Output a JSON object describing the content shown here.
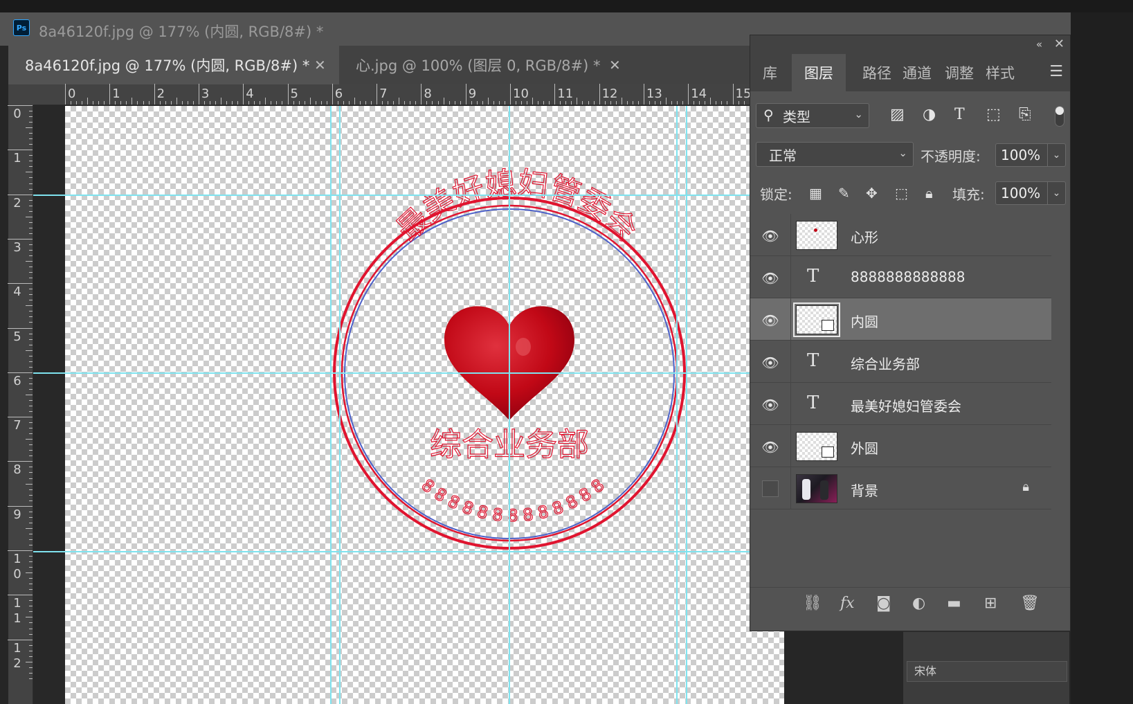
{
  "window": {
    "title": "8a46120f.jpg @ 177% (内圆, RGB/8#) *",
    "app_icon": "Ps"
  },
  "tabs": [
    {
      "label": "8a46120f.jpg @ 177% (内圆, RGB/8#) *",
      "active": true
    },
    {
      "label": "心.jpg @ 100% (图层 0, RGB/8#) *",
      "active": false
    }
  ],
  "ruler": {
    "top_labels": [
      "0",
      "1",
      "2",
      "3",
      "4",
      "5",
      "6",
      "7",
      "8",
      "9",
      "10",
      "11",
      "12",
      "13",
      "14",
      "15"
    ],
    "left_labels": [
      "0",
      "1",
      "2",
      "3",
      "4",
      "5",
      "6",
      "7",
      "8",
      "9",
      "10",
      "11",
      "12"
    ]
  },
  "stamp": {
    "arc_text": "最美好媳妇管委会",
    "department_text": "综合业务部",
    "number_text": "8888888888888",
    "color": "#e0142f"
  },
  "guides_color": "#7fe3ef",
  "panel": {
    "collapse_icon": "«",
    "close_icon": "✕",
    "tabs": [
      "库",
      "图层",
      "路径",
      "通道",
      "调整",
      "样式"
    ],
    "active_tab": "图层",
    "menu_icon": "menu-icon",
    "filter_label": "类型",
    "blend_mode": "正常",
    "opacity_label": "不透明度:",
    "opacity_value": "100%",
    "lock_label": "锁定:",
    "fill_label": "填充:",
    "fill_value": "100%",
    "layers": [
      {
        "name": "心形",
        "type": "pixel",
        "visible": true,
        "selected": false
      },
      {
        "name": "8888888888888",
        "type": "text",
        "visible": true,
        "selected": false
      },
      {
        "name": "内圆",
        "type": "shape",
        "visible": true,
        "selected": true
      },
      {
        "name": "综合业务部",
        "type": "text",
        "visible": true,
        "selected": false
      },
      {
        "name": "最美好媳妇管委会",
        "type": "text",
        "visible": true,
        "selected": false
      },
      {
        "name": "外圆",
        "type": "shape",
        "visible": true,
        "selected": false
      },
      {
        "name": "背景",
        "type": "photo",
        "visible": false,
        "selected": false,
        "locked": true
      }
    ]
  },
  "under_panel": {
    "field_text": "宋体"
  }
}
